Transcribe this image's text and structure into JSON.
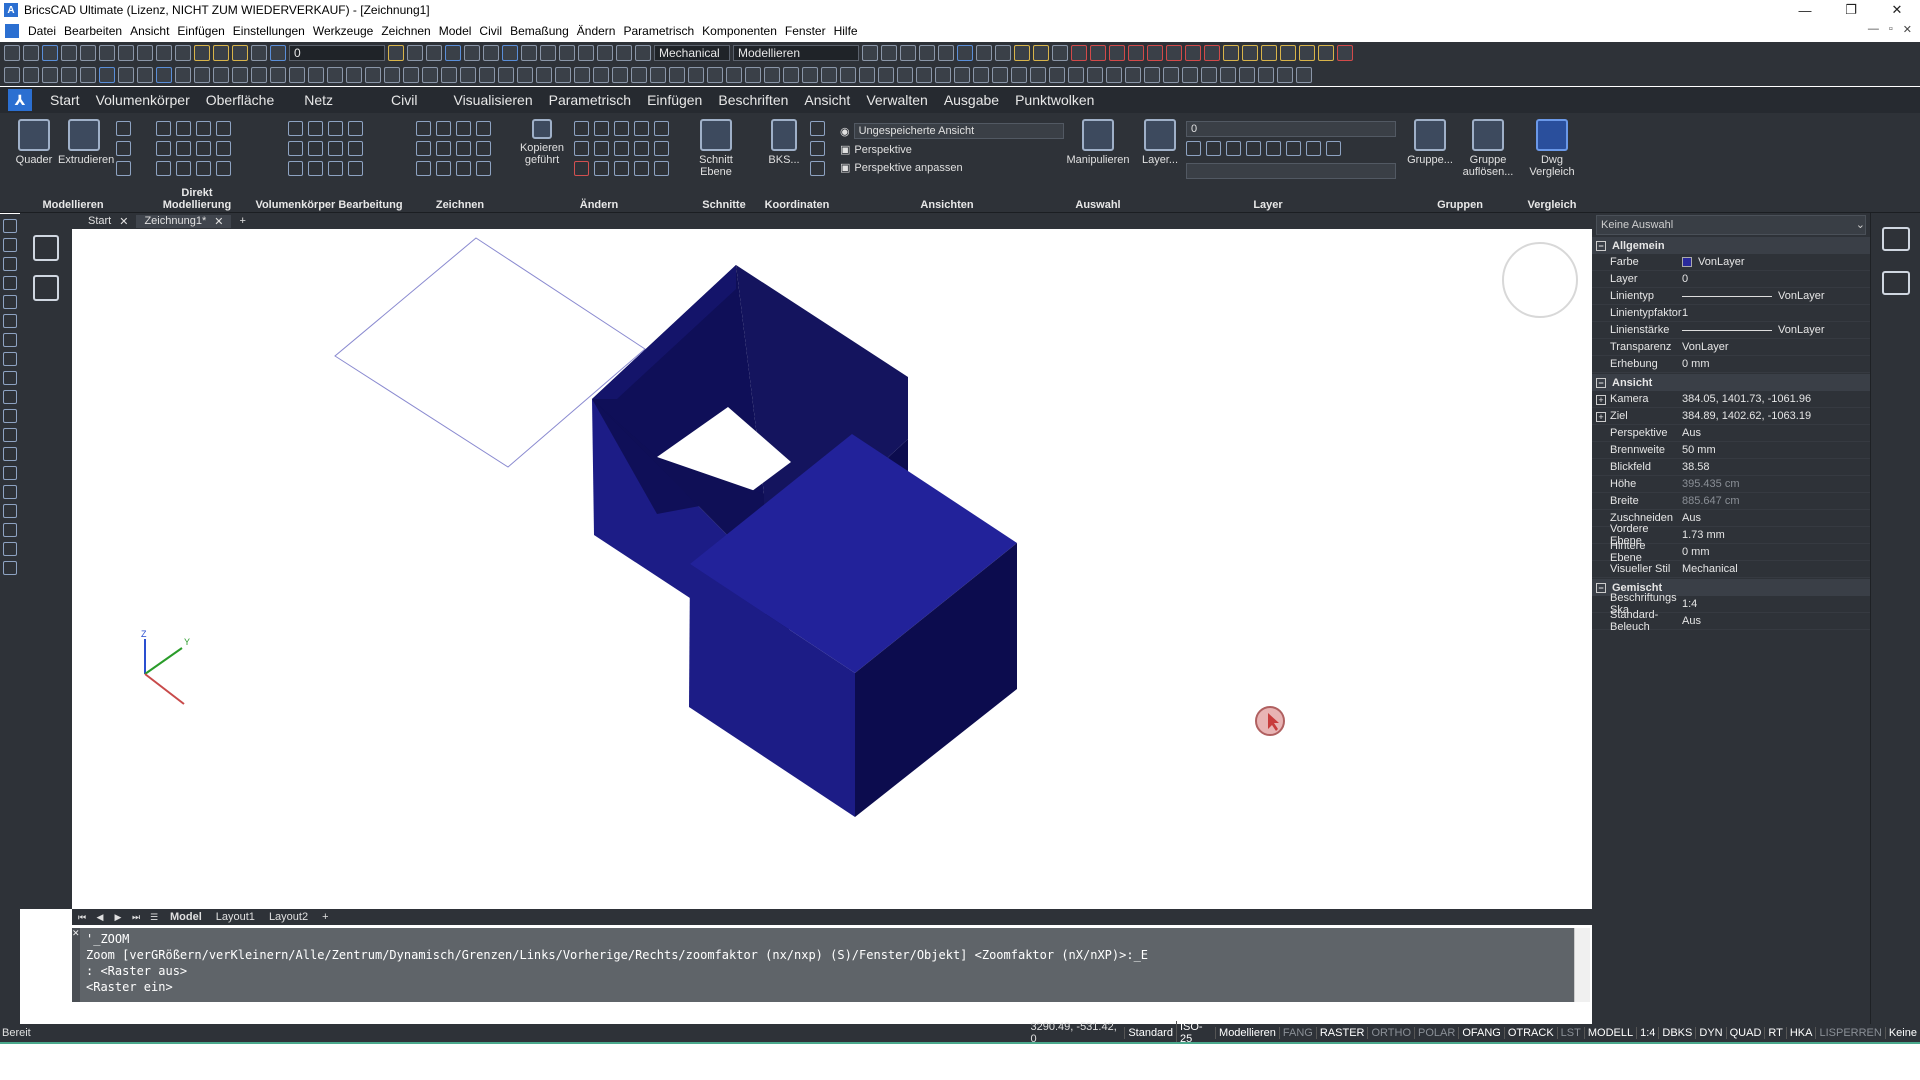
{
  "window": {
    "title": "BricsCAD Ultimate (Lizenz, NICHT ZUM WIEDERVERKAUF) - [Zeichnung1]",
    "controls": [
      "—",
      "❐",
      "✕"
    ]
  },
  "menu": [
    "Datei",
    "Bearbeiten",
    "Ansicht",
    "Einfügen",
    "Einstellungen",
    "Werkzeuge",
    "Zeichnen",
    "Model",
    "Civil",
    "Bemaßung",
    "Ändern",
    "Parametrisch",
    "Komponenten",
    "Fenster",
    "Hilfe"
  ],
  "toolbar": {
    "layer_value": "0",
    "style_value": "Mechanical",
    "workspace_value": "Modellieren"
  },
  "ribbon_tabs": [
    "Start",
    "Volumenkörper",
    "Oberfläche",
    "Netz",
    "Civil",
    "Visualisieren",
    "Parametrisch",
    "Einfügen",
    "Beschriften",
    "Ansicht",
    "Verwalten",
    "Ausgabe",
    "Punktwolken"
  ],
  "ribbon": {
    "panels": [
      "Modellieren",
      "Direkt Modellierung",
      "Volumenkörper Bearbeitung",
      "Zeichnen",
      "Ändern",
      "Schnitte",
      "Koordinaten",
      "Ansichten",
      "Auswahl",
      "Layer",
      "Gruppen",
      "Vergleich"
    ],
    "buttons": {
      "quader": "Quader",
      "extrudieren": "Extrudieren",
      "kopieren": "Kopieren geführt",
      "schnitt": "Schnitt Ebene",
      "bks": "BKS...",
      "manipulieren": "Manipulieren",
      "layer": "Layer...",
      "gruppe": "Gruppe...",
      "gruppe_aufloesen": "Gruppe auflösen...",
      "dwg_vergleich": "Dwg Vergleich"
    },
    "views": {
      "named_view": "Ungespeicherte Ansicht",
      "perspective": "Perspektive",
      "adjust_perspective": "Perspektive anpassen"
    },
    "layer_value": "0"
  },
  "doc_tabs": [
    {
      "label": "Start"
    },
    {
      "label": "Zeichnung1*"
    }
  ],
  "layout_tabs": [
    "Model",
    "Layout1",
    "Layout2",
    "+"
  ],
  "command_line": [
    "'_ZOOM",
    "Zoom [verGRößern/verKleinern/Alle/Zentrum/Dynamisch/Grenzen/Links/Vorherige/Rechts/zoomfaktor (nx/nxp) (S)/Fenster/Objekt] <Zoomfaktor (nX/nXP)>:_E",
    ": <Raster aus>",
    "<Raster ein>"
  ],
  "status": {
    "ready": "Bereit",
    "coords": "3290.49, -531.42, 0",
    "items": [
      {
        "label": "Standard",
        "on": true
      },
      {
        "label": "ISO-25",
        "on": true
      },
      {
        "label": "Modellieren",
        "on": true
      },
      {
        "label": "FANG",
        "on": false
      },
      {
        "label": "RASTER",
        "on": true
      },
      {
        "label": "ORTHO",
        "on": false
      },
      {
        "label": "POLAR",
        "on": false
      },
      {
        "label": "OFANG",
        "on": true
      },
      {
        "label": "OTRACK",
        "on": true
      },
      {
        "label": "LST",
        "on": false
      },
      {
        "label": "MODELL",
        "on": true
      },
      {
        "label": "1:4",
        "on": true
      },
      {
        "label": "DBKS",
        "on": true
      },
      {
        "label": "DYN",
        "on": true
      },
      {
        "label": "QUAD",
        "on": true
      },
      {
        "label": "RT",
        "on": true
      },
      {
        "label": "HKA",
        "on": true
      },
      {
        "label": "LISPERREN",
        "on": false
      },
      {
        "label": "Keine",
        "on": true
      }
    ]
  },
  "properties": {
    "selector": "Keine Auswahl",
    "allgemein": {
      "title": "Allgemein",
      "rows": [
        {
          "key": "Farbe",
          "value": "VonLayer"
        },
        {
          "key": "Layer",
          "value": "0"
        },
        {
          "key": "Linientyp",
          "value": "VonLayer"
        },
        {
          "key": "Linientypfaktor",
          "value": "1"
        },
        {
          "key": "Linienstärke",
          "value": "VonLayer"
        },
        {
          "key": "Transparenz",
          "value": "VonLayer"
        },
        {
          "key": "Erhebung",
          "value": "0 mm"
        }
      ]
    },
    "ansicht": {
      "title": "Ansicht",
      "rows": [
        {
          "key": "Kamera",
          "value": "384.05, 1401.73, -1061.96"
        },
        {
          "key": "Ziel",
          "value": "384.89, 1402.62, -1063.19"
        },
        {
          "key": "Perspektive",
          "value": "Aus"
        },
        {
          "key": "Brennweite",
          "value": "50 mm"
        },
        {
          "key": "Blickfeld",
          "value": "38.58"
        },
        {
          "key": "Höhe",
          "value": "395.435 cm"
        },
        {
          "key": "Breite",
          "value": "885.647 cm"
        },
        {
          "key": "Zuschneiden",
          "value": "Aus"
        },
        {
          "key": "Vordere Ebene",
          "value": "1.73 mm"
        },
        {
          "key": "Hintere Ebene",
          "value": "0 mm"
        },
        {
          "key": "Visueller Stil",
          "value": "Mechanical"
        }
      ]
    },
    "gemischt": {
      "title": "Gemischt",
      "rows": [
        {
          "key": "Beschriftungs Ska",
          "value": "1:4"
        },
        {
          "key": "Standard-Beleuch",
          "value": "Aus"
        }
      ]
    }
  },
  "colors": {
    "solid_top": "#22229a",
    "solid_left": "#1c1c86",
    "solid_right": "#0c0c4e",
    "inner_wall": "#14145e"
  },
  "ucs_labels": {
    "z": "Z",
    "y": "Y"
  }
}
